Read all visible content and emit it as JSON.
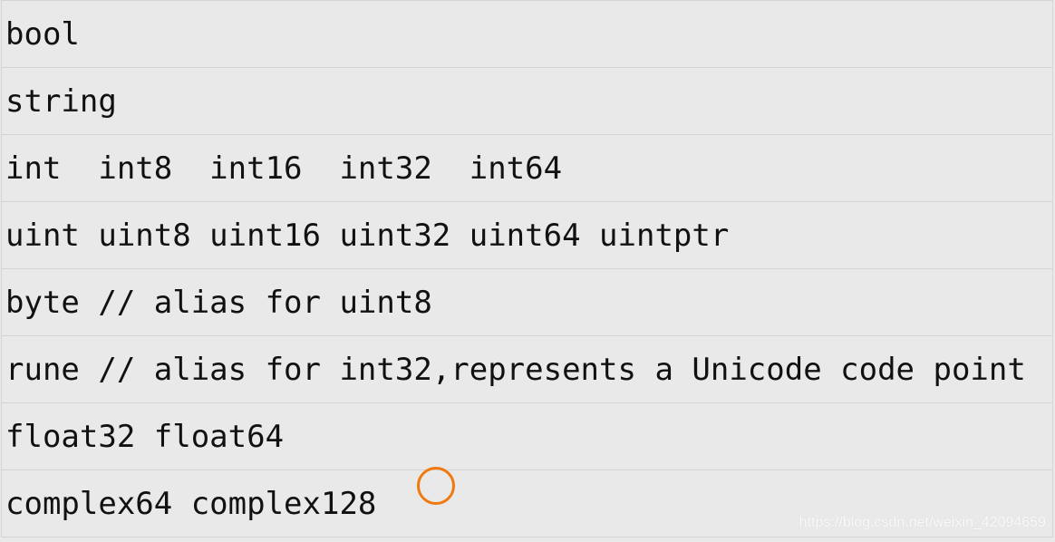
{
  "rows": [
    "bool",
    "string",
    "int  int8  int16  int32  int64",
    "uint uint8 uint16 uint32 uint64 uintptr",
    "byte // alias for uint8",
    "rune // alias for int32,represents a Unicode code point",
    "float32 float64",
    "complex64 complex128"
  ],
  "watermark": "https://blog.csdn.net/weixin_42094659",
  "colors": {
    "background": "#e9e9e9",
    "cursor": "#ef7a12"
  }
}
